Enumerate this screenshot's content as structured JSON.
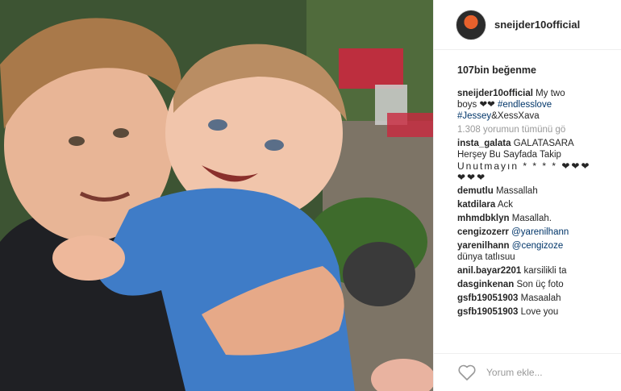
{
  "post": {
    "username": "sneijder10official",
    "likes": "107bin beğenme",
    "caption": {
      "user": "sneijder10official",
      "text_start": "My two",
      "text_line2": "boys ❤❤ ",
      "tag1": "#endlesslove",
      "tag2": "#Jessey",
      "text_end": "&XessXava"
    },
    "view_all": "1.308 yorumun tümünü gö",
    "comments": [
      {
        "user": "insta_galata",
        "text": "GALATASARA",
        "line2": "Herşey Bu Sayfada Takip",
        "line3": "Unutmayın * * * * ❤❤❤",
        "line4": "❤❤❤"
      },
      {
        "user": "demutlu",
        "text": "Massallah"
      },
      {
        "user": "katdilara",
        "text": "Ack"
      },
      {
        "user": "mhmdbklyn",
        "text": "Masallah."
      },
      {
        "user": "cengizozerr",
        "mention": "@yarenilhann"
      },
      {
        "user": "yarenilhann",
        "mention": "@cengizoze",
        "line2": "dünya tatlısuu"
      },
      {
        "user": "anil.bayar2201",
        "text": "karsilikli ta"
      },
      {
        "user": "dasginkenan",
        "text": "Son üç foto"
      },
      {
        "user": "gsfb19051903",
        "text": "Masaalah"
      },
      {
        "user": "gsfb19051903",
        "text": "Love you"
      }
    ],
    "comment_placeholder": "Yorum ekle..."
  },
  "icons": {
    "like": "heart-outline-icon"
  },
  "colors": {
    "link": "#003569",
    "muted": "#999999",
    "text": "#262626"
  }
}
